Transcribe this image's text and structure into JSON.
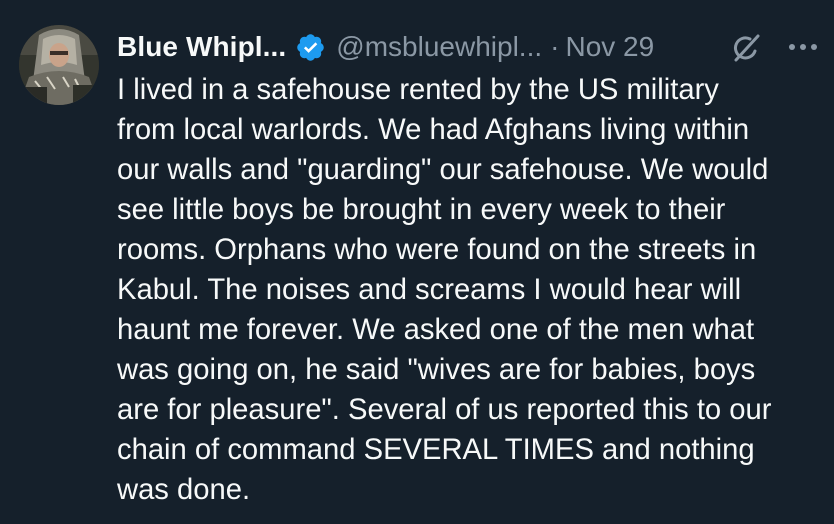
{
  "colors": {
    "background": "#15202b",
    "text_primary": "#f7f9f9",
    "text_secondary": "#8b98a5",
    "verified_badge": "#1d9bf0"
  },
  "author": {
    "display_name": "Blue Whipl...",
    "handle": "@msbluewhipl...",
    "verified_icon": "verified-badge-icon",
    "avatar": "avatar"
  },
  "meta": {
    "separator": "·",
    "date": "Nov 29"
  },
  "actions": {
    "grok_icon": "grok-icon",
    "more_icon": "more-icon"
  },
  "tweet": {
    "text": "I lived in a safehouse rented by the US military\nfrom local warlords. We had Afghans living within\nour walls and \"guarding\" our safehouse. We would\nsee little boys be brought in every week to their\nrooms. Orphans who were found on the streets in\nKabul. The noises and screams I would hear will\nhaunt me forever. We asked one of the men what\nwas going on, he said \"wives are for babies, boys\nare for pleasure\". Several of us reported this to our\nchain of command SEVERAL TIMES and nothing\nwas done."
  }
}
